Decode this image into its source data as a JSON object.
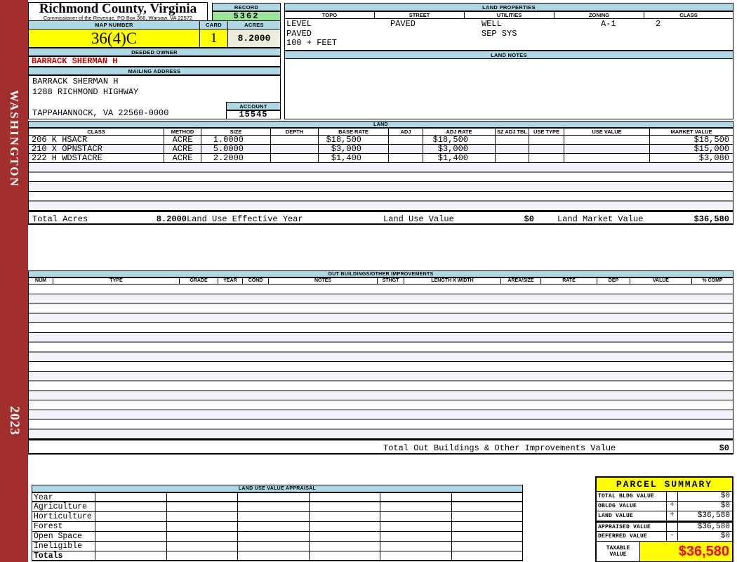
{
  "colors": {
    "header_blue": "#ADD8E6",
    "record_green": "#99E699",
    "highlight_yellow": "#FFFF00",
    "cream": "#EDEDDE",
    "sidebar_red": "#A32E2E",
    "owner_red": "#CC0000",
    "taxable_red": "#FF0000",
    "stripe": "#F2F2FA"
  },
  "sidebar": {
    "district": "WASHINGTON",
    "year": "2023"
  },
  "county": {
    "title": "Richmond County, Virginia",
    "subtitle": "Commissioner of the Revenue, PO Box 366, Warsaw, VA 22572"
  },
  "record": {
    "label": "RECORD",
    "value": "5362"
  },
  "map": {
    "label": "MAP NUMBER",
    "value": "36(4)C"
  },
  "card": {
    "label": "CARD",
    "value": "1"
  },
  "acres": {
    "label": "ACRES",
    "value": "8.2000"
  },
  "deeded_owner": {
    "label": "DEEDED OWNER",
    "value": "BARRACK SHERMAN H"
  },
  "mailing": {
    "label": "MAILING ADDRESS",
    "line1": "BARRACK SHERMAN H",
    "line2": "1288 RICHMOND HIGHWAY",
    "line3": "TAPPAHANNOCK, VA 22560-0000"
  },
  "account": {
    "label": "ACCOUNT",
    "value": "15545"
  },
  "land_properties": {
    "label": "LAND PROPERTIES",
    "columns": [
      "TOPO",
      "STREET",
      "UTILITIES",
      "ZONING",
      "CLASS"
    ],
    "topo1": "LEVEL",
    "topo2": "PAVED",
    "topo3": "100 + FEET",
    "street": "PAVED",
    "utilities1": "WELL",
    "utilities2": "SEP SYS",
    "zoning": "A-1",
    "class": "2"
  },
  "land_notes": {
    "label": "LAND NOTES"
  },
  "land_table": {
    "label": "LAND",
    "columns": [
      "CLASS",
      "METHOD",
      "SIZE",
      "DEPTH",
      "BASE RATE",
      "ADJ",
      "ADJ RATE",
      "SZ ADJ TBL",
      "USE TYPE",
      "USE VALUE",
      "MARKET VALUE"
    ],
    "rows": [
      {
        "class": "206 K HSACR",
        "method": "ACRE",
        "size": "1.0000",
        "depth": "",
        "base_rate": "$18,500",
        "adj": "",
        "adj_rate": "$18,500",
        "sz_adj_tbl": "",
        "use_type": "",
        "use_value": "",
        "market_value": "$18,500"
      },
      {
        "class": "210 X OPNSTACR",
        "method": "ACRE",
        "size": "5.0000",
        "depth": "",
        "base_rate": "$3,000",
        "adj": "",
        "adj_rate": "$3,000",
        "sz_adj_tbl": "",
        "use_type": "",
        "use_value": "",
        "market_value": "$15,000"
      },
      {
        "class": "222 H WDSTACRE",
        "method": "ACRE",
        "size": "2.2000",
        "depth": "",
        "base_rate": "$1,400",
        "adj": "",
        "adj_rate": "$1,400",
        "sz_adj_tbl": "",
        "use_type": "",
        "use_value": "",
        "market_value": "$3,080"
      }
    ],
    "totals": {
      "total_acres_label": "Total Acres",
      "total_acres": "8.2000",
      "effective_year_label": "Land Use Effective Year",
      "use_value_label": "Land Use Value",
      "use_value": "$0",
      "market_value_label": "Land Market Value",
      "market_value": "$36,580"
    }
  },
  "out_buildings": {
    "label": "OUT BUILDINGS/OTHER IMPROVEMENTS",
    "columns": [
      "NUM",
      "TYPE",
      "GRADE",
      "YEAR",
      "COND",
      "NOTES",
      "STHGT",
      "LENGTH X WIDTH",
      "AREA/SIZE",
      "RATE",
      "DEP",
      "VALUE",
      "% COMP"
    ],
    "total_label": "Total Out Buildings & Other Improvements Value",
    "total_value": "$0"
  },
  "land_use_appraisal": {
    "label": "LAND USE VALUE APPRAISAL",
    "rows": [
      "Year",
      "Agriculture",
      "Horticulture",
      "Forest",
      "Open Space",
      "Ineligible",
      "Totals"
    ]
  },
  "parcel_summary": {
    "label": "PARCEL SUMMARY",
    "rows": [
      {
        "label": "TOTAL BLDG VALUE",
        "op": "",
        "value": "$0"
      },
      {
        "label": "OBLDG VALUE",
        "op": "+",
        "value": "$0"
      },
      {
        "label": "LAND VALUE",
        "op": "+",
        "value": "$36,580"
      },
      {
        "label": "APPRAISED VALUE",
        "op": "",
        "value": "$36,580"
      },
      {
        "label": "DEFERRED VALUE",
        "op": "-",
        "value": "$0"
      }
    ],
    "taxable": {
      "label1": "TAXABLE",
      "label2": "VALUE",
      "value": "$36,580"
    }
  }
}
